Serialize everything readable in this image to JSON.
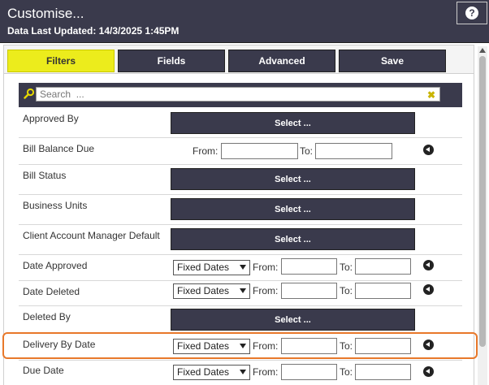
{
  "header": {
    "title": "Customise...",
    "subtitle": "Data Last Updated: 14/3/2025 1:45PM",
    "help_label": "?"
  },
  "tabs": [
    {
      "label": "Filters",
      "active": true
    },
    {
      "label": "Fields",
      "active": false
    },
    {
      "label": "Advanced",
      "active": false
    },
    {
      "label": "Save",
      "active": false
    }
  ],
  "search": {
    "placeholder": "Search  ...",
    "value": ""
  },
  "common": {
    "select_label": "Select ...",
    "from_label": "From:",
    "to_label": "To:",
    "date_mode": "Fixed Dates"
  },
  "filters": [
    {
      "label": "Approved By",
      "type": "select"
    },
    {
      "label": "Bill Balance Due",
      "type": "range"
    },
    {
      "label": "Bill Status",
      "type": "select"
    },
    {
      "label": "Business Units",
      "type": "select"
    },
    {
      "label": "Client Account Manager Default",
      "type": "select"
    },
    {
      "label": "Date Approved",
      "type": "date"
    },
    {
      "label": "Date Deleted",
      "type": "date"
    },
    {
      "label": "Deleted By",
      "type": "select"
    },
    {
      "label": "Delivery By Date",
      "type": "date",
      "highlighted": true
    },
    {
      "label": "Due Date",
      "type": "date"
    }
  ],
  "colors": {
    "header_bg": "#3a3a4c",
    "active_tab": "#ecec1c",
    "highlight_border": "#e8782a"
  }
}
